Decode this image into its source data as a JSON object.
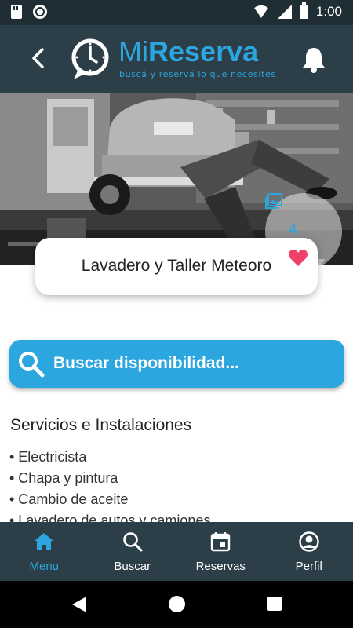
{
  "status_bar": {
    "time": "1:00",
    "icons": [
      "sd-card-icon",
      "record-icon",
      "wifi-icon",
      "signal-icon",
      "battery-icon"
    ]
  },
  "header": {
    "logo_text_mi": "Mi",
    "logo_text_reserva": "Reserva",
    "tagline": "buscá y reservá lo que necesites",
    "accent_color": "#2ba6de",
    "background_color": "#2c3e48"
  },
  "hero": {
    "photo_count": "4"
  },
  "business": {
    "name": "Lavadero y Taller Meteoro",
    "favorite_color": "#f0406a"
  },
  "search": {
    "label": "Buscar disponibilidad..."
  },
  "services": {
    "title": "Servicios e Instalaciones",
    "items": [
      "• Electricista",
      "• Chapa y pintura",
      "• Cambio de aceite",
      "• Lavadero de autos y camiones"
    ]
  },
  "bottom_nav": {
    "items": [
      {
        "label": "Menu",
        "icon": "home-icon",
        "active": true
      },
      {
        "label": "Buscar",
        "icon": "search-icon",
        "active": false
      },
      {
        "label": "Reservas",
        "icon": "calendar-icon",
        "active": false
      },
      {
        "label": "Perfil",
        "icon": "user-icon",
        "active": false
      }
    ]
  }
}
